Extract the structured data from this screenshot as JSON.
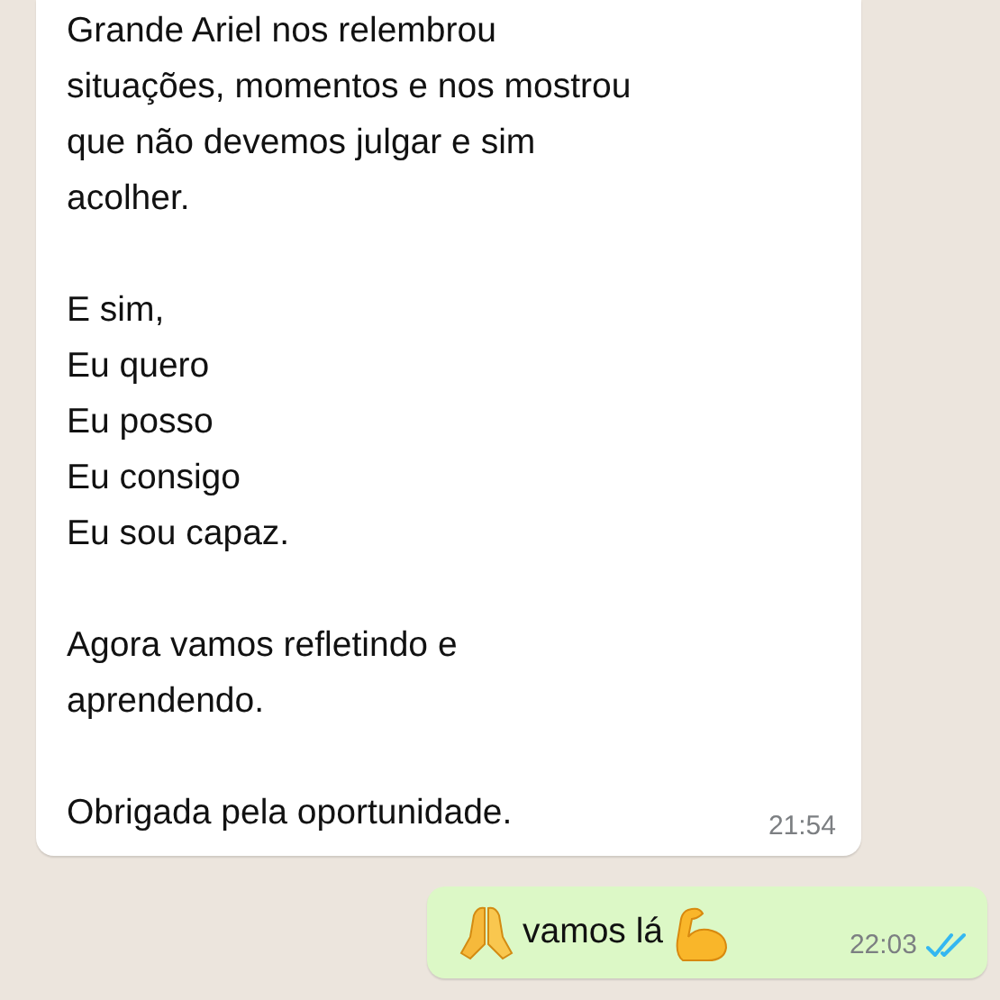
{
  "messages": [
    {
      "kind": "incoming",
      "paragraphs": [
        "Grande Ariel nos relembrou\nsituações, momentos e nos mostrou\nque não devemos julgar e sim\nacolher.",
        "E sim,\nEu quero\nEu posso\nEu consigo\nEu sou capaz.",
        "Agora vamos refletindo e\naprendendo.",
        "Obrigada pela oportunidade."
      ],
      "time": "21:54"
    },
    {
      "kind": "outgoing",
      "parts": [
        {
          "kind": "pray"
        },
        {
          "kind": "text",
          "text": "vamos lá"
        },
        {
          "kind": "biceps"
        }
      ],
      "time": "22:03",
      "read": true
    }
  ]
}
